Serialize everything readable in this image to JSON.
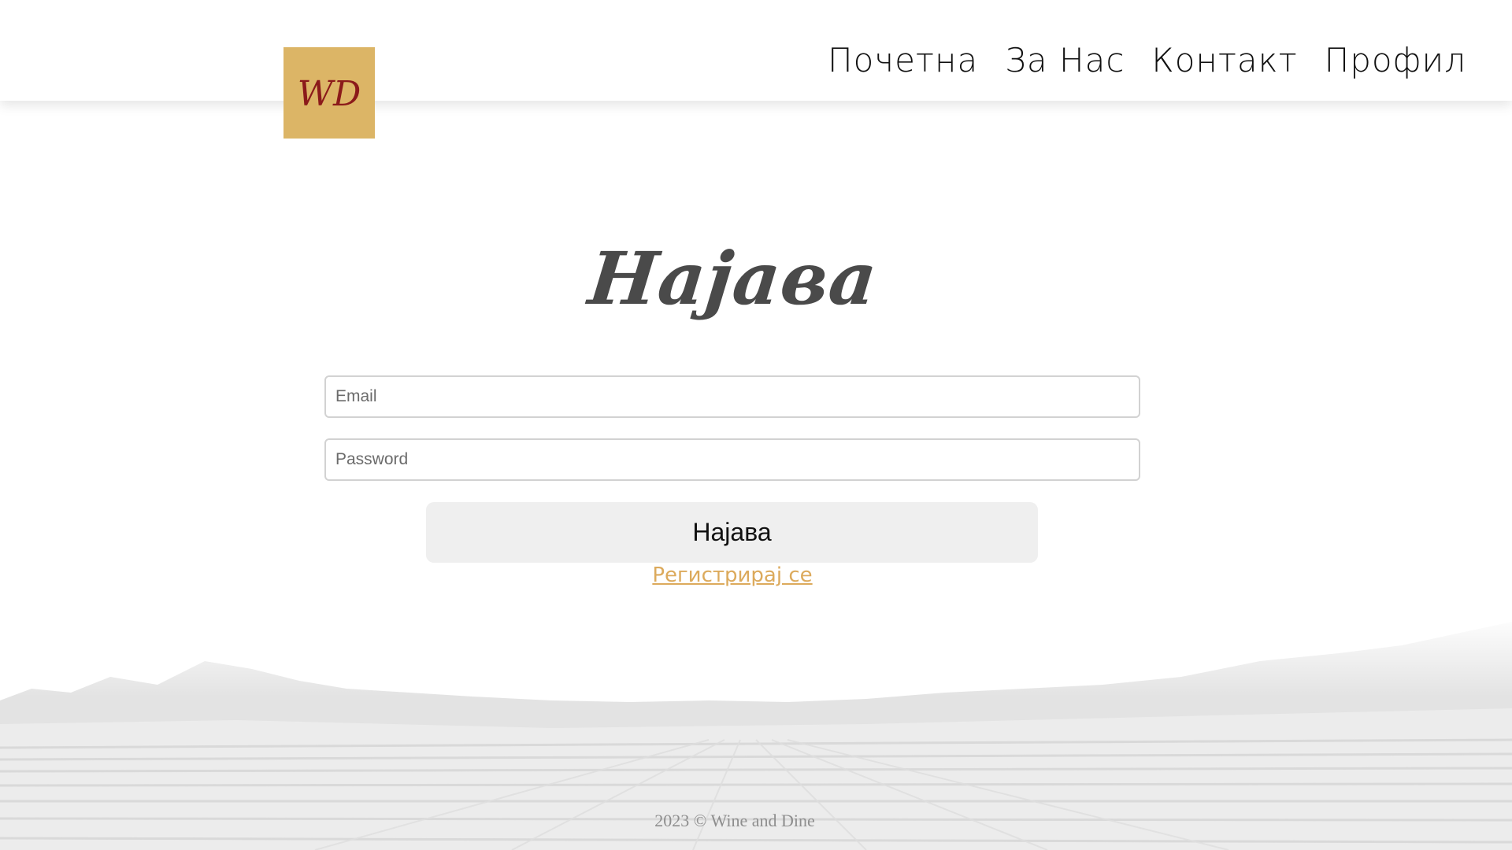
{
  "header": {
    "logo_text": "WD",
    "nav": [
      {
        "label": "Почетна"
      },
      {
        "label": "За Нас"
      },
      {
        "label": "Контакт"
      },
      {
        "label": "Профил"
      }
    ]
  },
  "login": {
    "title": "Најава",
    "email_placeholder": "Email",
    "password_placeholder": "Password",
    "submit_label": "Најава",
    "register_label": "Регистрирај се"
  },
  "footer": {
    "copyright": "2023 © Wine and Dine"
  },
  "colors": {
    "logo_bg": "#dcb566",
    "logo_fg": "#8b1a1a",
    "link": "#dcaa5c",
    "button_bg": "#efefef"
  }
}
